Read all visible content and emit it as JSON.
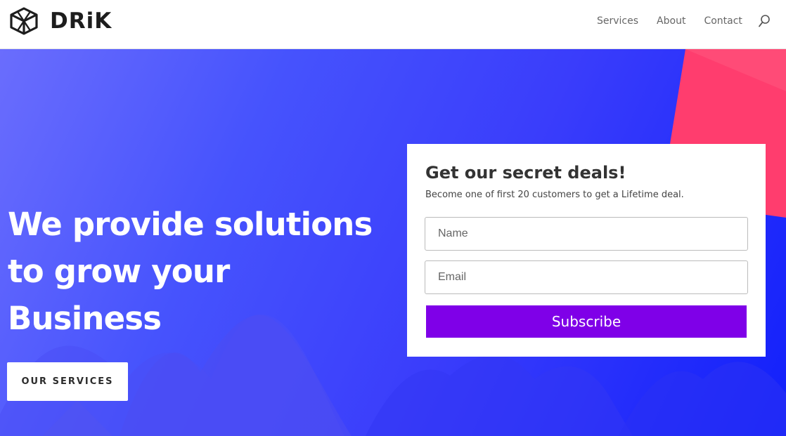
{
  "brand": {
    "logo_text": "DRiK",
    "logo_icon": "cube-logo-icon"
  },
  "nav": {
    "items": [
      {
        "label": "Services"
      },
      {
        "label": "About"
      },
      {
        "label": "Contact"
      }
    ],
    "search_icon": "search-icon"
  },
  "hero": {
    "headline_lines": [
      "We provide solutions",
      "to grow your",
      "Business"
    ],
    "cta_label": "OUR SERVICES"
  },
  "subscribe": {
    "title": "Get our secret deals!",
    "subtitle": "Become one of first 20 customers to get a Lifetime deal.",
    "name_placeholder": "Name",
    "email_placeholder": "Email",
    "button_label": "Subscribe"
  },
  "colors": {
    "hero_gradient_start": "#6a6dfd",
    "hero_gradient_end": "#1220fb",
    "accent_pink": "#ff3d6e",
    "subscribe_button": "#7f00e8"
  }
}
